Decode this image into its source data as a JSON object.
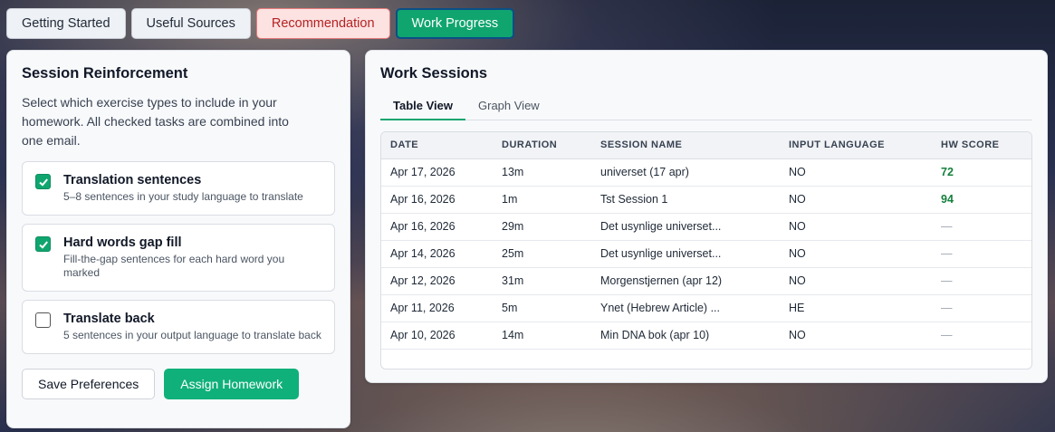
{
  "tabs": {
    "getting_started": "Getting Started",
    "useful_sources": "Useful Sources",
    "recommendation": "Recommendation",
    "work_progress": "Work Progress"
  },
  "reinforcement": {
    "title": "Session Reinforcement",
    "description": "Select which exercise types to include in your homework. All checked tasks are combined into one email.",
    "options": [
      {
        "title": "Translation sentences",
        "subtitle": "5–8 sentences in your study language to translate",
        "checked": true
      },
      {
        "title": "Hard words gap fill",
        "subtitle": "Fill-the-gap sentences for each hard word you marked",
        "checked": true
      },
      {
        "title": "Translate back",
        "subtitle": "5 sentences in your output language to translate back",
        "checked": false
      }
    ],
    "save_label": "Save Preferences",
    "assign_label": "Assign Homework"
  },
  "sessions": {
    "title": "Work Sessions",
    "view_tabs": {
      "table": "Table View",
      "graph": "Graph View"
    },
    "columns": [
      "DATE",
      "DURATION",
      "SESSION NAME",
      "INPUT LANGUAGE",
      "HW SCORE"
    ],
    "rows": [
      [
        "Apr 17, 2026",
        "13m",
        "universet (17 apr)",
        "NO",
        "72"
      ],
      [
        "Apr 16, 2026",
        "1m",
        "Tst Session 1",
        "NO",
        "94"
      ],
      [
        "Apr 16, 2026",
        "29m",
        "Det usynlige universet...",
        "NO",
        "—"
      ],
      [
        "Apr 14, 2026",
        "25m",
        "Det usynlige universet...",
        "NO",
        "—"
      ],
      [
        "Apr 12, 2026",
        "31m",
        "Morgenstjernen (apr 12)",
        "NO",
        "—"
      ],
      [
        "Apr 11, 2026",
        "5m",
        "Ynet (Hebrew Article) ...",
        "HE",
        "—"
      ],
      [
        "Apr 10, 2026",
        "14m",
        "Min DNA bok (apr 10)",
        "NO",
        "—"
      ]
    ]
  },
  "colors": {
    "accent": "#10a56f",
    "score": "#15803d",
    "recommendation": "#fde2e2"
  }
}
